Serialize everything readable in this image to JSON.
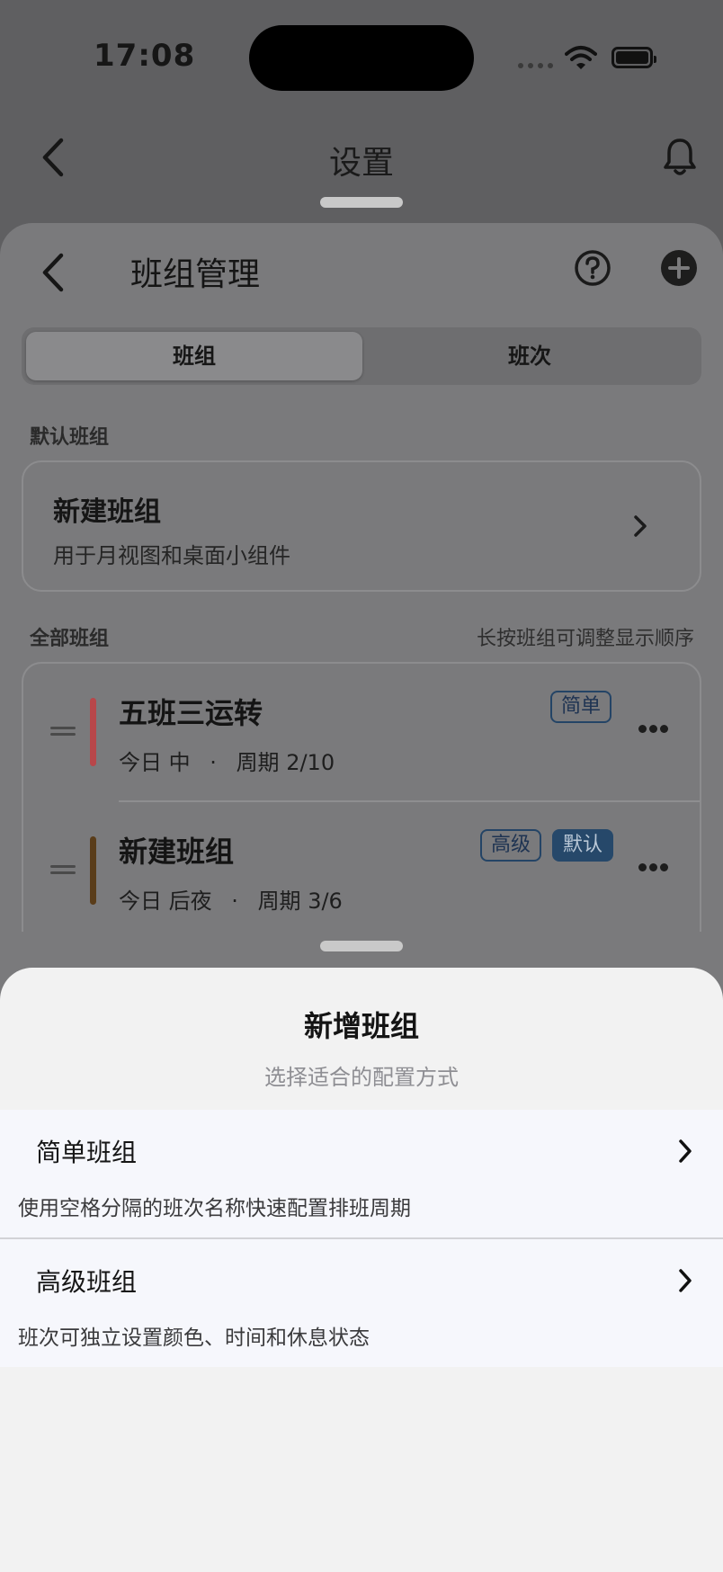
{
  "status_bar": {
    "time": "17:08"
  },
  "settings_screen": {
    "title": "设置"
  },
  "group_management": {
    "title": "班组管理",
    "segments": {
      "active": "班组",
      "inactive": "班次"
    },
    "default_section": {
      "label": "默认班组",
      "card": {
        "title": "新建班组",
        "subtitle": "用于月视图和桌面小组件"
      }
    },
    "all_section": {
      "label": "全部班组",
      "hint": "长按班组可调整显示顺序",
      "rows": [
        {
          "name": "五班三运转",
          "today_label": "今日",
          "today_value": "中",
          "dot": "·",
          "cycle": "周期 2/10",
          "tags": [
            "简单"
          ],
          "bar_color": "#b8474a"
        },
        {
          "name": "新建班组",
          "today_label": "今日",
          "today_value": "后夜",
          "dot": "·",
          "cycle": "周期 3/6",
          "tags": [
            "高级",
            "默认"
          ],
          "bar_color": "#5a3d1a"
        }
      ]
    }
  },
  "add_sheet": {
    "title": "新增班组",
    "subtitle": "选择适合的配置方式",
    "options": [
      {
        "title": "简单班组",
        "description": "使用空格分隔的班次名称快速配置排班周期"
      },
      {
        "title": "高级班组",
        "description": "班次可独立设置颜色、时间和休息状态"
      }
    ]
  }
}
